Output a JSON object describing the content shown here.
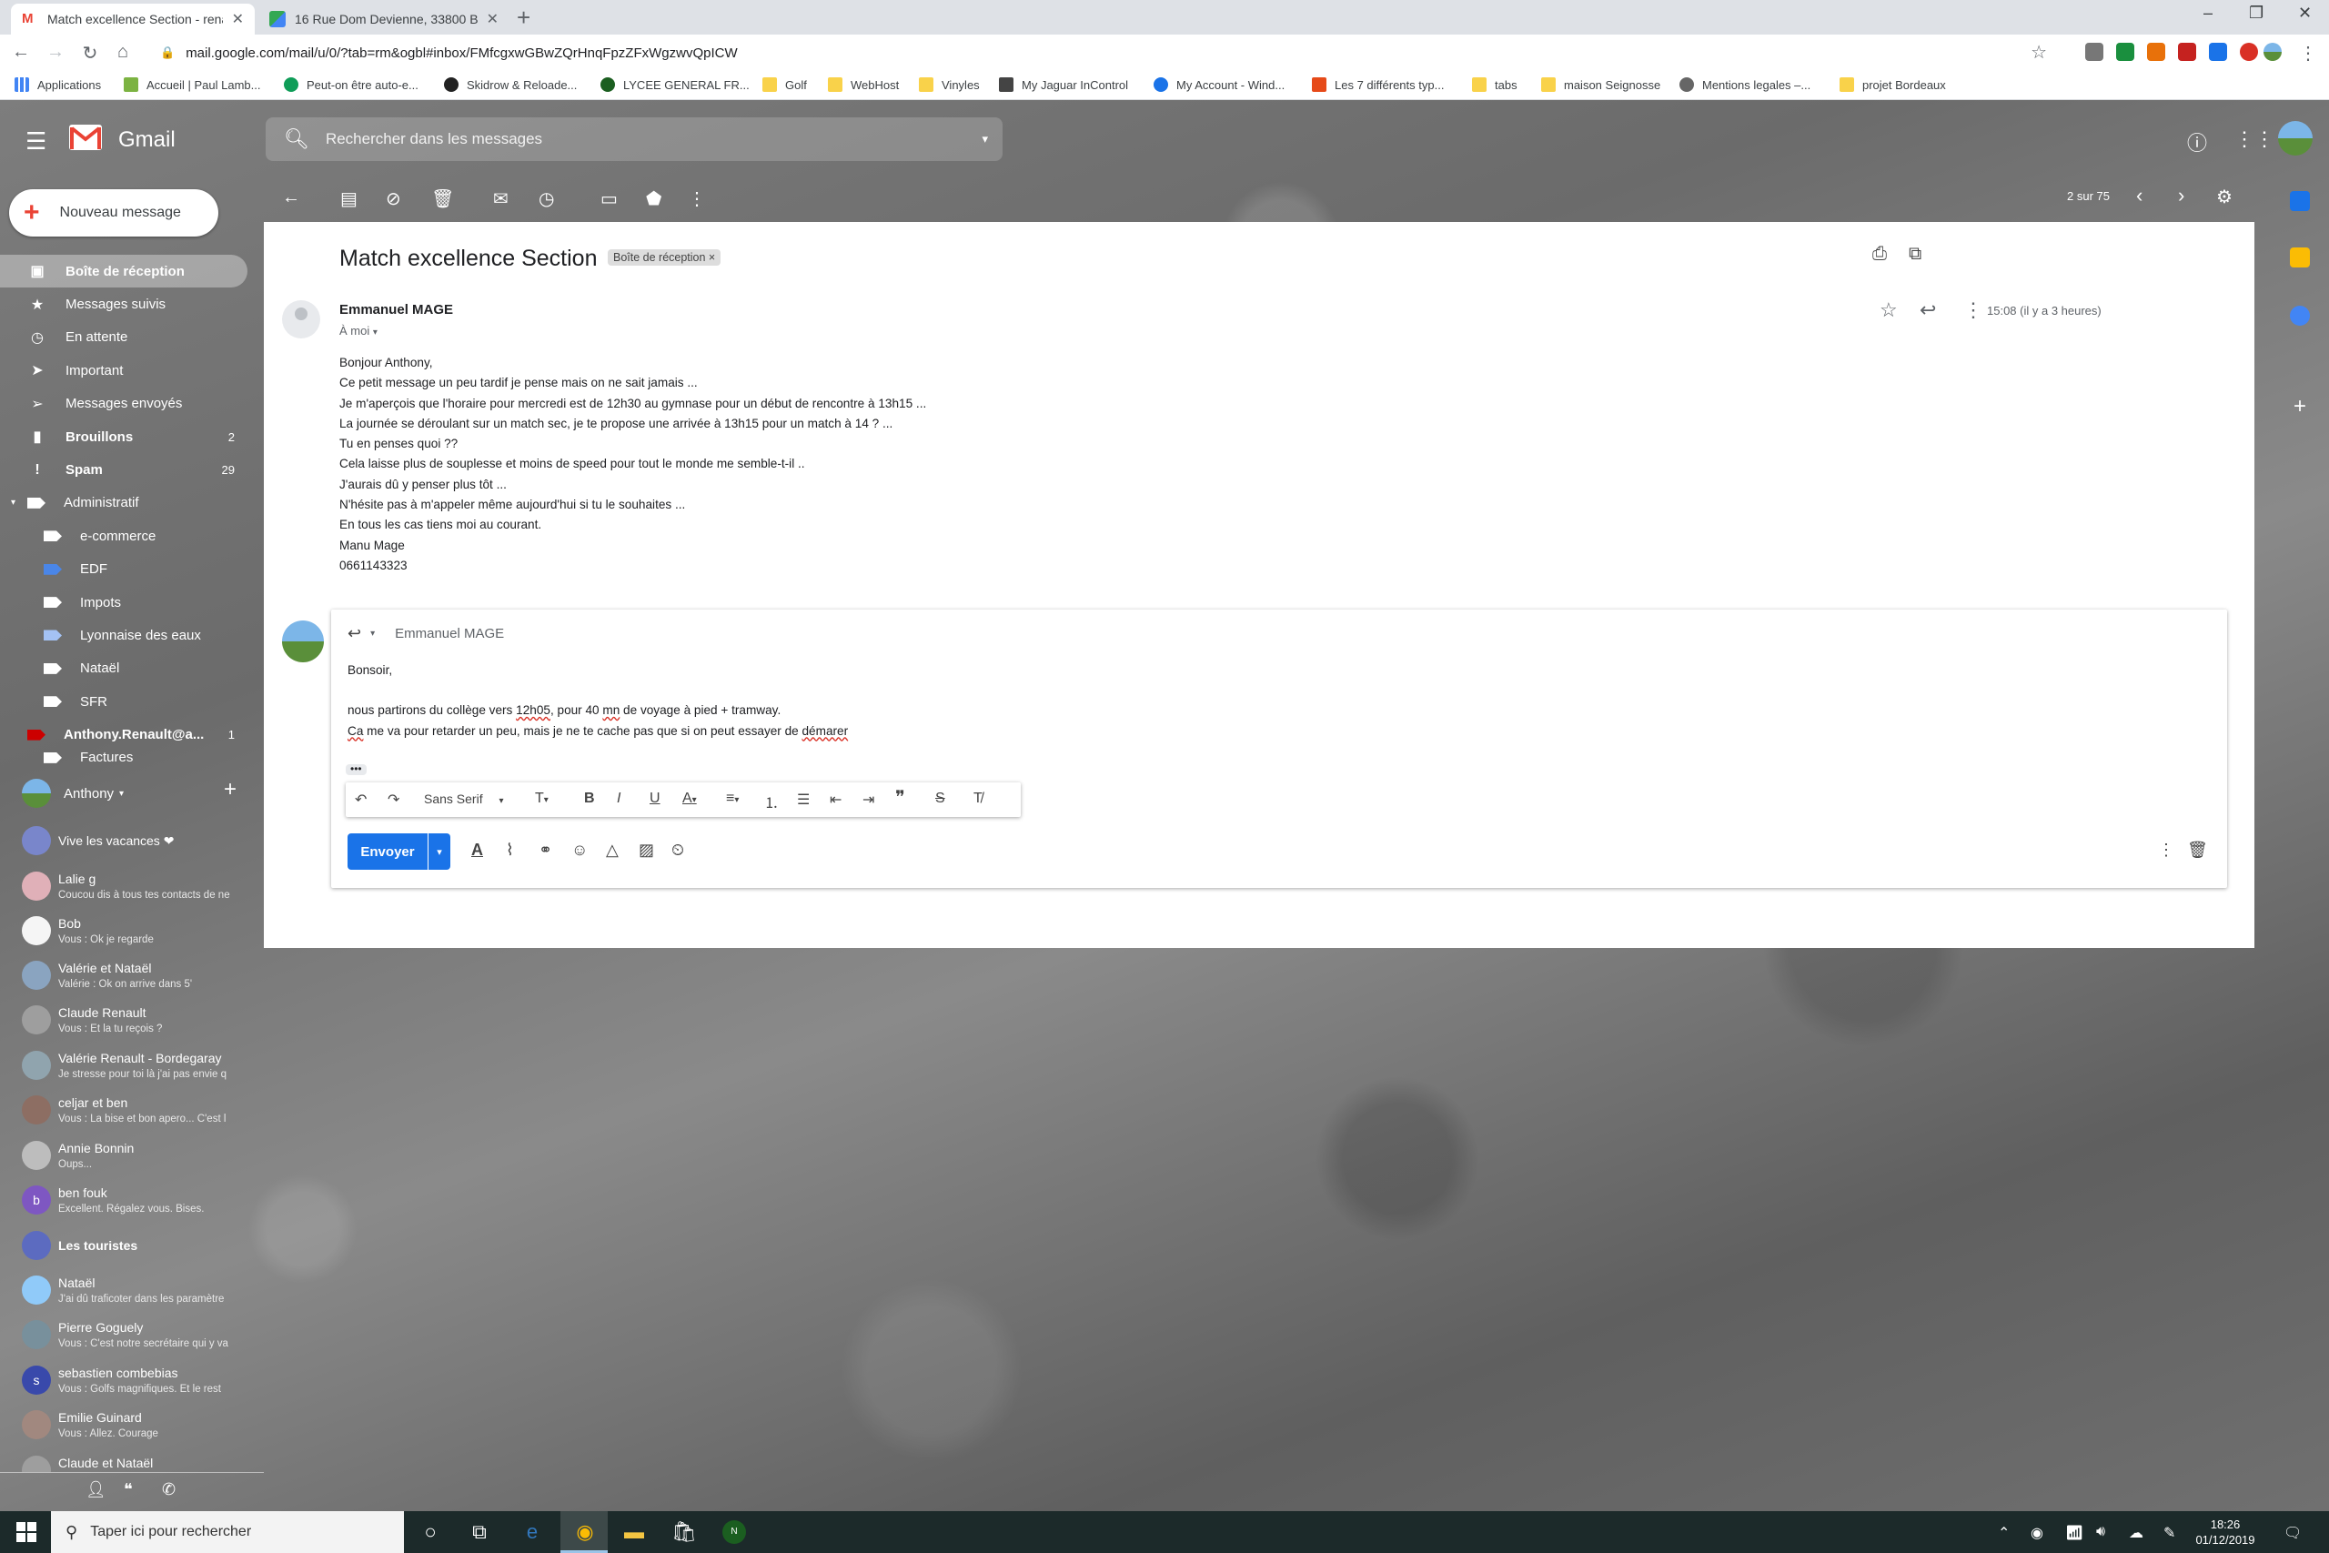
{
  "browser": {
    "tabs": [
      {
        "title": "Match excellence Section - renau",
        "active": true
      },
      {
        "title": "16 Rue Dom Devienne, 33800 Bo",
        "active": false
      }
    ],
    "url": "mail.google.com/mail/u/0/?tab=rm&ogbl#inbox/FMfcgxwGBwZQrHnqFpzZFxWgzwvQpICW",
    "bookmarks": [
      "Applications",
      "Accueil | Paul Lamb...",
      "Peut-on être auto-e...",
      "Skidrow & Reloade...",
      "LYCEE GENERAL FR...",
      "Golf",
      "WebHost",
      "Vinyles",
      "My Jaguar InControl",
      "My Account - Wind...",
      "Les 7 différents typ...",
      "tabs",
      "maison Seignosse",
      "Mentions legales –...",
      "projet Bordeaux"
    ]
  },
  "gmail": {
    "brand": "Gmail",
    "search_placeholder": "Rechercher dans les messages",
    "compose_label": "Nouveau message",
    "nav": [
      {
        "label": "Boîte de réception",
        "icon": "inbox-icon",
        "count": ""
      },
      {
        "label": "Messages suivis",
        "icon": "star-icon",
        "count": ""
      },
      {
        "label": "En attente",
        "icon": "clock-icon",
        "count": ""
      },
      {
        "label": "Important",
        "icon": "important-icon",
        "count": ""
      },
      {
        "label": "Messages envoyés",
        "icon": "send-icon",
        "count": ""
      },
      {
        "label": "Brouillons",
        "icon": "draft-icon",
        "count": "2"
      },
      {
        "label": "Spam",
        "icon": "spam-icon",
        "count": "29"
      },
      {
        "label": "Administratif",
        "icon": "label-icon",
        "count": ""
      },
      {
        "label": "e-commerce",
        "icon": "label-icon",
        "count": ""
      },
      {
        "label": "EDF",
        "icon": "label-icon",
        "count": ""
      },
      {
        "label": "Impots",
        "icon": "label-icon",
        "count": ""
      },
      {
        "label": "Lyonnaise des eaux",
        "icon": "label-icon",
        "count": ""
      },
      {
        "label": "Nataël",
        "icon": "label-icon",
        "count": ""
      },
      {
        "label": "SFR",
        "icon": "label-icon",
        "count": ""
      },
      {
        "label": "Anthony.Renault@a...",
        "icon": "label-icon",
        "count": "1"
      },
      {
        "label": "Factures",
        "icon": "label-icon",
        "count": ""
      }
    ],
    "hangouts": {
      "me": "Anthony",
      "contacts": [
        {
          "name": "Vive les vacances ❤",
          "msg": ""
        },
        {
          "name": "Lalie g",
          "msg": "Coucou dis à tous tes contacts de ne"
        },
        {
          "name": "Bob",
          "msg": "Vous : Ok je regarde"
        },
        {
          "name": "Valérie et Nataël",
          "msg": "Valérie : Ok on arrive dans 5'"
        },
        {
          "name": "Claude Renault",
          "msg": "Vous : Et la tu reçois ?"
        },
        {
          "name": "Valérie Renault - Bordegaray",
          "msg": "Je stresse pour toi là j'ai pas envie q"
        },
        {
          "name": "celjar et ben",
          "msg": "Vous : La bise et bon apero... C'est l"
        },
        {
          "name": "Annie Bonnin",
          "msg": "Oups..."
        },
        {
          "name": "ben fouk",
          "msg": "Excellent. Régalez vous. Bises."
        },
        {
          "name": "Les touristes",
          "msg": ""
        },
        {
          "name": "Nataël",
          "msg": "J'ai dû traficoter dans les paramètre"
        },
        {
          "name": "Pierre Goguely",
          "msg": "Vous : C'est notre secrétaire qui y va"
        },
        {
          "name": "sebastien combebias",
          "msg": "Vous : Golfs magnifiques. Et le rest"
        },
        {
          "name": "Emilie Guinard",
          "msg": "Vous : Allez. Courage"
        },
        {
          "name": "Claude et Nataël",
          "msg": ""
        }
      ]
    },
    "pager": "2 sur 75",
    "message": {
      "subject": "Match excellence Section",
      "badge": "Boîte de réception ×",
      "sender": "Emmanuel MAGE",
      "to": "À moi",
      "time": "15:08 (il y a 3 heures)",
      "body": [
        "Bonjour Anthony,",
        "Ce petit message un peu tardif je pense mais on ne sait jamais ...",
        "Je m'aperçois que l'horaire pour mercredi est de 12h30 au gymnase pour un début de rencontre à 13h15 ...",
        "La journée se déroulant sur un match sec, je te propose une arrivée à 13h15 pour un match à 14 ? ...",
        "Tu en penses quoi ??",
        "Cela laisse plus de souplesse et moins de speed pour tout le monde me semble-t-il ..",
        "J'aurais dû y penser plus tôt ...",
        "N'hésite pas à m'appeler même aujourd'hui si tu le souhaites ...",
        "En tous les cas tiens moi au courant.",
        "Manu Mage",
        "0661143323"
      ]
    },
    "reply": {
      "to": "Emmanuel MAGE",
      "greeting": "Bonsoir,",
      "line1_a": "nous partirons du collège vers ",
      "line1_b": "12h05",
      "line1_c": ", pour 40 ",
      "line1_d": "mn",
      "line1_e": " de voyage à pied + tramway.",
      "line2_a": "Ca",
      "line2_b": " me va pour retarder un peu, mais je ne te cache pas que si on peut essayer de ",
      "line2_c": "démarer",
      "font": "Sans Serif",
      "send_label": "Envoyer"
    }
  },
  "taskbar": {
    "search_placeholder": "Taper ici pour rechercher",
    "time": "18:26",
    "date": "01/12/2019"
  }
}
